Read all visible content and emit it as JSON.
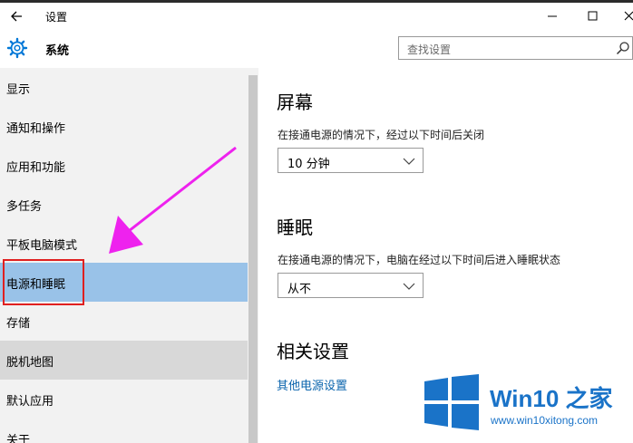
{
  "window": {
    "title": "设置"
  },
  "header": {
    "app_name": "系统",
    "search_placeholder": "查找设置"
  },
  "sidebar": {
    "items": [
      {
        "label": "显示",
        "state": "normal"
      },
      {
        "label": "通知和操作",
        "state": "normal"
      },
      {
        "label": "应用和功能",
        "state": "normal"
      },
      {
        "label": "多任务",
        "state": "normal"
      },
      {
        "label": "平板电脑模式",
        "state": "normal"
      },
      {
        "label": "电源和睡眠",
        "state": "selected"
      },
      {
        "label": "存储",
        "state": "normal"
      },
      {
        "label": "脱机地图",
        "state": "hover"
      },
      {
        "label": "默认应用",
        "state": "normal"
      },
      {
        "label": "关于",
        "state": "normal"
      }
    ]
  },
  "main": {
    "screen": {
      "title": "屏幕",
      "desc": "在接通电源的情况下，经过以下时间后关闭",
      "value": "10 分钟"
    },
    "sleep": {
      "title": "睡眠",
      "desc": "在接通电源的情况下，电脑在经过以下时间后进入睡眠状态",
      "value": "从不"
    },
    "related": {
      "title": "相关设置",
      "link": "其他电源设置"
    }
  },
  "watermark": {
    "brand": "Win10 之家",
    "url": "www.win10xitong.com"
  },
  "colors": {
    "selected": "#99c2e8",
    "highlight_box": "#e02020",
    "arrow": "#ee22ee",
    "link": "#0a64ad",
    "accent": "#0078d7"
  }
}
